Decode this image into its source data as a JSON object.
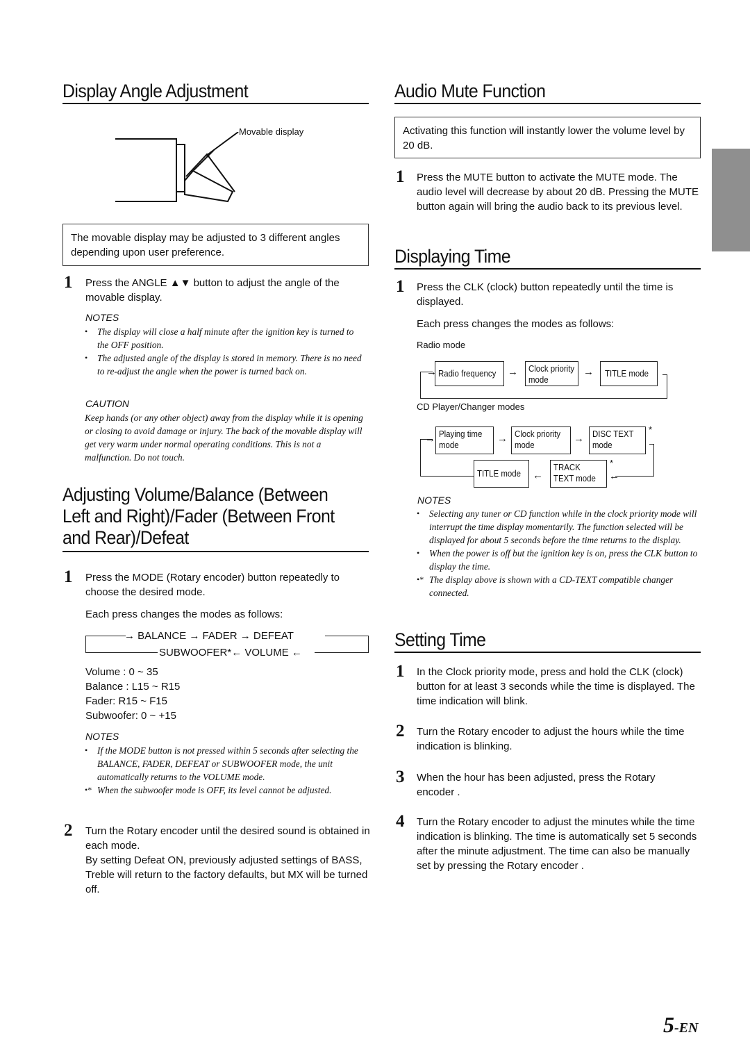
{
  "page": {
    "number": "5",
    "suffix": "-EN",
    "side_tab_color": "#8f8f8f"
  },
  "display_angle": {
    "title": "Display Angle Adjustment",
    "figure_label": "Movable display",
    "intro": "The movable display may be adjusted to 3 different angles depending upon user preference.",
    "steps": [
      {
        "num": "1",
        "text": "Press the ANGLE ▲▼ button to adjust the angle of the movable display."
      }
    ],
    "notes_heading": "NOTES",
    "notes": [
      "The display will close a half minute after the ignition key is turned to the OFF position.",
      "The adjusted angle of the display is stored in memory. There is no need to re-adjust the angle when the power is turned back on."
    ],
    "caution_heading": "CAUTION",
    "caution": "Keep hands (or any other object) away from the display while it is opening or closing to avoid damage or injury. The back of the movable display will get very warm under normal operating conditions. This is not a malfunction. Do not touch."
  },
  "volume": {
    "title_lines": [
      "Adjusting Volume/Balance (Between",
      "Left and Right)/Fader (Between Front",
      "and Rear)/Defeat"
    ],
    "step1": {
      "num": "1",
      "text": "Press the MODE (Rotary encoder)   button repeatedly to choose the desired mode."
    },
    "each_press": "Each press changes the modes as follows:",
    "cycle_top": [
      "BALANCE",
      "FADER",
      "DEFEAT"
    ],
    "cycle_bottom": [
      "SUBWOOFER*",
      "VOLUME"
    ],
    "ranges": [
      "Volume : 0 ~ 35",
      "Balance : L15 ~ R15",
      "Fader:  R15 ~ F15",
      "Subwoofer: 0 ~ +15"
    ],
    "notes_heading": "NOTES",
    "notes": [
      {
        "bullet": "•",
        "text": "If the MODE button is not pressed within 5 seconds after selecting the BALANCE, FADER, DEFEAT or SUBWOOFER mode, the unit automatically returns to the VOLUME mode."
      },
      {
        "bullet": "•*",
        "text": "When the subwoofer mode is OFF, its level cannot be adjusted."
      }
    ],
    "step2": {
      "num": "2",
      "text": "Turn the Rotary encoder   until the desired sound is obtained in each mode.",
      "extra": "By setting Defeat ON, previously adjusted settings of BASS, Treble will return to the factory defaults, but MX will be turned off."
    }
  },
  "mute": {
    "title": "Audio Mute Function",
    "intro": "Activating this function will instantly lower the volume level by 20 dB.",
    "steps": [
      {
        "num": "1",
        "text": "Press the MUTE button to activate the MUTE mode. The audio level will decrease by about 20 dB. Pressing the MUTE button again will bring the audio back to its previous level."
      }
    ]
  },
  "display_time": {
    "title": "Displaying Time",
    "step1": {
      "num": "1",
      "text": "Press the CLK (clock) button repeatedly until the time is displayed."
    },
    "each_press": "Each press changes the modes as follows:",
    "radio_label": "Radio mode",
    "radio_flow": [
      [
        "Radio frequency"
      ],
      [
        "Clock priority",
        "mode"
      ],
      [
        "TITLE mode"
      ]
    ],
    "cd_label": "CD Player/Changer modes",
    "cd_flow_top": [
      [
        "Playing time",
        "mode"
      ],
      [
        "Clock priority",
        "mode"
      ],
      [
        "DISC TEXT",
        "mode"
      ]
    ],
    "cd_flow_bottom": [
      [
        "TITLE mode"
      ],
      [
        "TRACK",
        "TEXT mode"
      ]
    ],
    "asterisk": "*",
    "notes_heading": "NOTES",
    "notes": [
      {
        "bullet": "•",
        "text": "Selecting any tuner or CD function while in the clock priority mode will interrupt the time display momentarily. The function selected will be displayed for about 5 seconds before the time returns to the display."
      },
      {
        "bullet": "•",
        "text": "When the power is off but the ignition key is on, press the CLK button to display the time."
      },
      {
        "bullet": "•*",
        "text": "The display above is shown with a CD-TEXT compatible changer connected."
      }
    ]
  },
  "setting_time": {
    "title": "Setting Time",
    "steps": [
      {
        "num": "1",
        "text": "In the Clock priority mode, press and hold the CLK (clock) button for at least 3 seconds while the time is displayed. The time indication will blink."
      },
      {
        "num": "2",
        "text": "Turn the Rotary encoder   to adjust the hours while the time indication is blinking."
      },
      {
        "num": "3",
        "text": "When the hour has been adjusted, press the Rotary encoder ."
      },
      {
        "num": "4",
        "text": "Turn the Rotary encoder   to adjust the minutes while the time indication is blinking. The time is automatically set 5 seconds after the minute adjustment. The time can also be manually set by pressing the Rotary encoder ."
      }
    ]
  }
}
